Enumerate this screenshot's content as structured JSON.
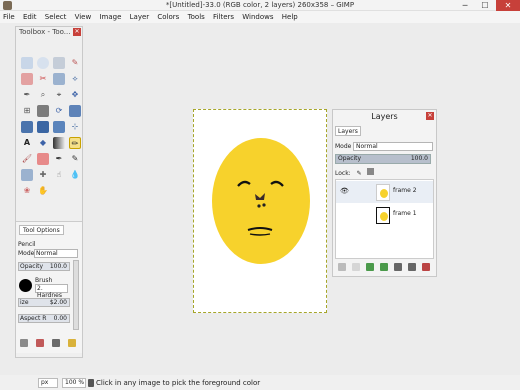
{
  "window": {
    "title": "*[Untitled]-33.0 (RGB color, 2 layers) 260x358 – GIMP",
    "minimize_glyph": "─",
    "maximize_glyph": "☐",
    "close_glyph": "✕"
  },
  "menu": [
    "File",
    "Edit",
    "Select",
    "View",
    "Image",
    "Layer",
    "Colors",
    "Tools",
    "Filters",
    "Windows",
    "Help"
  ],
  "toolbox": {
    "title": "Toolbox - Too...",
    "close_glyph": "✕",
    "fg_color": "#111111",
    "bg_color": "#f5ce21"
  },
  "tool_options": {
    "tab_label": "Tool Options",
    "tool_name": "Pencil",
    "mode_label": "Mode",
    "mode_value": "Normal",
    "opacity_label": "Opacity",
    "opacity_value": "100.0",
    "brush_label": "Brush",
    "brush_value": "2. Hardnes",
    "size_label": "ize",
    "size_value": "$2.00",
    "aspect_label": "Aspect R",
    "aspect_value": "0.00"
  },
  "layers": {
    "title": "Layers",
    "tab_label": "Layers",
    "close_glyph": "✕",
    "mode_label": "Mode",
    "mode_value": "Normal",
    "opacity_label": "Opacity",
    "opacity_value": "100.0",
    "lock_label": "Lock:",
    "items": [
      {
        "name": "frame 2"
      },
      {
        "name": "frame 1"
      }
    ]
  },
  "status": {
    "unit": "px",
    "zoom": "100 %",
    "message": "Click in any image to pick the foreground color"
  },
  "colors": {
    "face_yellow": "#f7d22c",
    "close_red": "#c7403a"
  }
}
